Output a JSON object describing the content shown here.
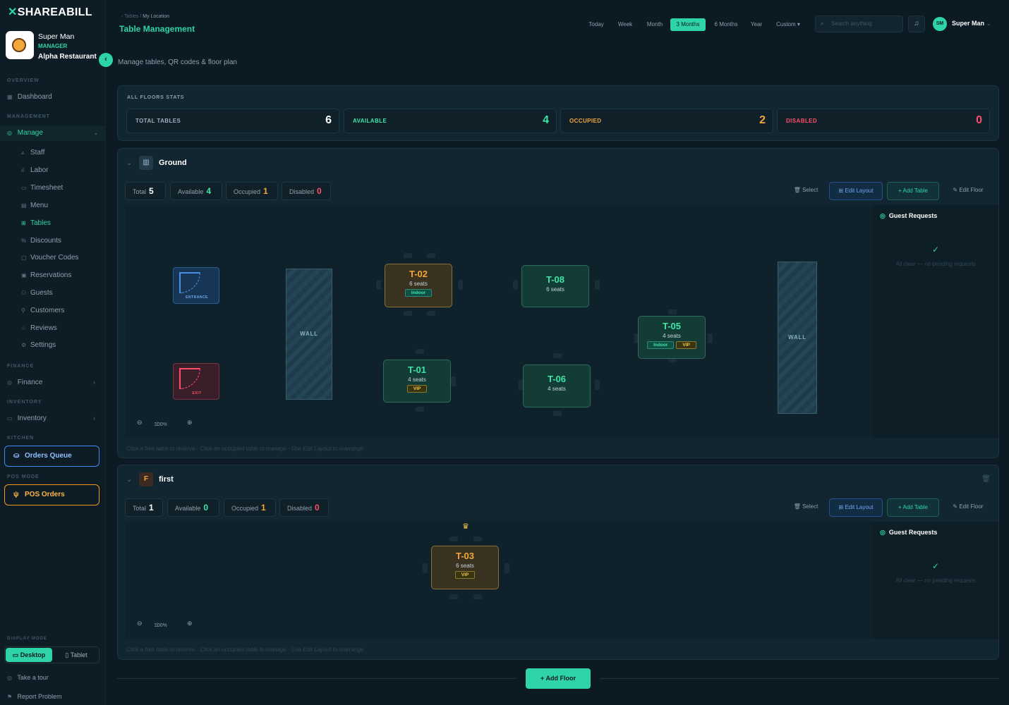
{
  "brand": {
    "mark": "✕",
    "name": "SHAREABILL"
  },
  "user": {
    "name": "Super Man",
    "role": "MANAGER",
    "restaurant": "Alpha Restaurant",
    "initials": "SM"
  },
  "sidebar": {
    "overview_label": "OVERVIEW",
    "dashboard": "Dashboard",
    "management_label": "MANAGEMENT",
    "manage": "Manage",
    "sub": [
      "Staff",
      "Labor",
      "Timesheet",
      "Menu",
      "Tables",
      "Discounts",
      "Voucher Codes",
      "Reservations",
      "Guests",
      "Customers",
      "Reviews",
      "Settings"
    ],
    "finance_label": "FINANCE",
    "finance": "Finance",
    "inventory_label": "INVENTORY",
    "inventory": "Inventory",
    "kitchen_label": "KITCHEN",
    "orders_queue": "Orders Queue",
    "pos_label": "POS MODE",
    "pos_orders": "POS Orders",
    "display_label": "DISPLAY MODE",
    "desktop": "Desktop",
    "tablet": "Tablet",
    "tour": "Take a tour",
    "report": "Report Problem"
  },
  "header": {
    "crumb_root": "Tables",
    "crumb_leaf": "My Location",
    "title": "Table Management",
    "subtitle": "Manage tables, QR codes & floor plan",
    "ranges": [
      "Today",
      "Week",
      "Month",
      "3 Months",
      "6 Months",
      "Year",
      "Custom ▾"
    ],
    "active_range": "3 Months",
    "search_placeholder": "Search anything"
  },
  "stats": {
    "title": "ALL FLOORS STATS",
    "items": [
      {
        "label": "TOTAL TABLES",
        "value": "6"
      },
      {
        "label": "AVAILABLE",
        "value": "4"
      },
      {
        "label": "OCCUPIED",
        "value": "2"
      },
      {
        "label": "DISABLED",
        "value": "0"
      }
    ]
  },
  "colors": {
    "accent": "#2fd3a8",
    "available": "#3ee6a5",
    "occupied": "#f5a63a",
    "disabled": "#ff4d6a"
  },
  "floors": [
    {
      "name": "Ground",
      "icon": "building-icon",
      "pills": {
        "total_label": "Total",
        "total": "5",
        "avail_label": "Available",
        "avail": "4",
        "occ_label": "Occupied",
        "occ": "1",
        "dis_label": "Disabled",
        "dis": "0"
      },
      "actions": {
        "select": "Select",
        "edit": "Edit Layout",
        "add": "Add Table",
        "edit_floor": "Edit Floor"
      },
      "entrance": "ENTRANCE",
      "exit": "EXIT",
      "wall": "WALL",
      "zoom": "100%",
      "tables": [
        {
          "id": "T-02",
          "seats": "6 seats",
          "status": "occupied",
          "badges": [
            "Indoor"
          ]
        },
        {
          "id": "T-08",
          "seats": "6 seats",
          "status": "available",
          "badges": []
        },
        {
          "id": "T-05",
          "seats": "4 seats",
          "status": "available",
          "badges": [
            "Indoor",
            "VIP"
          ]
        },
        {
          "id": "T-01",
          "seats": "4 seats",
          "status": "available",
          "badges": [
            "VIP"
          ]
        },
        {
          "id": "T-06",
          "seats": "4 seats",
          "status": "available",
          "badges": []
        }
      ],
      "guest_title": "Guest Requests",
      "guest_empty": "All clear — no pending requests",
      "hint": "Click a free table to reserve · Click an occupied table to manage · Use Edit Layout to rearrange"
    },
    {
      "name": "first",
      "icon": "f-icon",
      "pills": {
        "total_label": "Total",
        "total": "1",
        "avail_label": "Available",
        "avail": "0",
        "occ_label": "Occupied",
        "occ": "1",
        "dis_label": "Disabled",
        "dis": "0"
      },
      "actions": {
        "select": "Select",
        "edit": "Edit Layout",
        "add": "Add Table",
        "edit_floor": "Edit Floor"
      },
      "zoom": "100%",
      "tables": [
        {
          "id": "T-03",
          "seats": "6 seats",
          "status": "occupied",
          "badges": [
            "VIP"
          ]
        }
      ],
      "guest_title": "Guest Requests",
      "guest_empty": "All clear — no pending requests",
      "hint": "Click a free table to reserve · Click an occupied table to manage · Use Edit Layout to rearrange"
    }
  ],
  "add_floor": "Add Floor"
}
